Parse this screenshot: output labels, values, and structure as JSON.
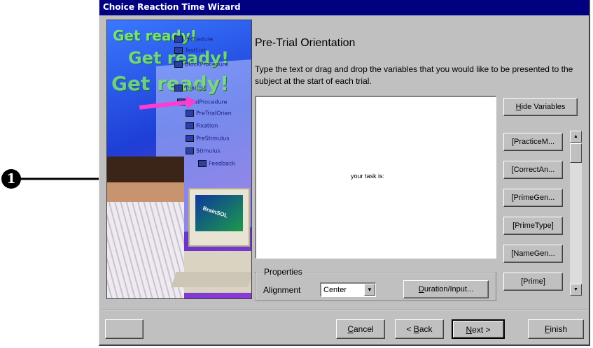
{
  "callout": {
    "number": "1"
  },
  "window": {
    "title": "Choice Reaction Time Wizard"
  },
  "picture": {
    "ready_text": "Get ready!",
    "tree_items": [
      "Procedure",
      "TestList",
      "BlockProcedure",
      "TrialList",
      "TrialProcedure",
      "PreTrialOrien",
      "Fixation",
      "PreStimulus",
      "Stimulus",
      "Feedback"
    ],
    "monitor_label": "BrainSOL"
  },
  "page": {
    "heading": "Pre-Trial Orientation",
    "instructions": "Type the text or drag and drop the variables that you would like to be presented to the subject at the start of each trial.",
    "textarea_content": "your task is:"
  },
  "properties": {
    "group_label": "Properties",
    "alignment_label": "Alignment",
    "alignment_value": "Center",
    "duration_button": {
      "first": "D",
      "rest": "uration/Input..."
    }
  },
  "variables": {
    "hide_button": {
      "first": "H",
      "rest": "ide Variables"
    },
    "items": [
      "[PracticeM...",
      "[CorrectAn...",
      "[PrimeGen...",
      "[PrimeType]",
      "[NameGen...",
      "[Prime]"
    ]
  },
  "nav": {
    "cancel": {
      "first": "C",
      "rest": "ancel"
    },
    "back_prefix": "< ",
    "back": {
      "first": "B",
      "rest": "ack"
    },
    "next": {
      "first": "N",
      "rest": "ext"
    },
    "next_suffix": " >",
    "finish": {
      "first": "F",
      "rest": "inish"
    }
  },
  "colors": {
    "titlebar": "#000080",
    "window_bg": "#c0c0c0",
    "pointer": "#ff3bd0"
  }
}
